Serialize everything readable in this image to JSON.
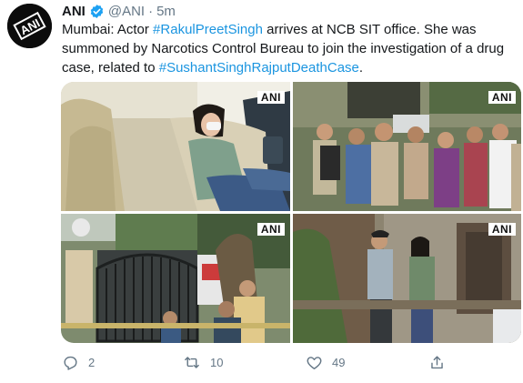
{
  "tweet": {
    "author_name": "ANI",
    "handle": "@ANI",
    "separator": "·",
    "time": "5m",
    "text_parts": [
      {
        "text": "Mumbai: Actor ",
        "type": "text"
      },
      {
        "text": "#RakulPreetSingh",
        "type": "hashtag"
      },
      {
        "text": " arrives at NCB SIT office. She was summoned by Narcotics Control Bureau to join the investigation of a drug case, related to ",
        "type": "text"
      },
      {
        "text": "#SushantSinghRajputDeathCase",
        "type": "hashtag"
      },
      {
        "text": ".",
        "type": "text"
      }
    ],
    "avatar_logo_text": "ANI"
  },
  "media": {
    "watermark": "ANI",
    "photos": [
      "car-interior-photo",
      "crowd-police-photo",
      "gate-street-photo",
      "walking-entrance-photo"
    ]
  },
  "actions": {
    "reply_count": "2",
    "retweet_count": "10",
    "like_count": "49"
  },
  "colors": {
    "link": "#1b95e0",
    "secondary_text": "#657786",
    "verified_badge": "#1da1f2"
  }
}
